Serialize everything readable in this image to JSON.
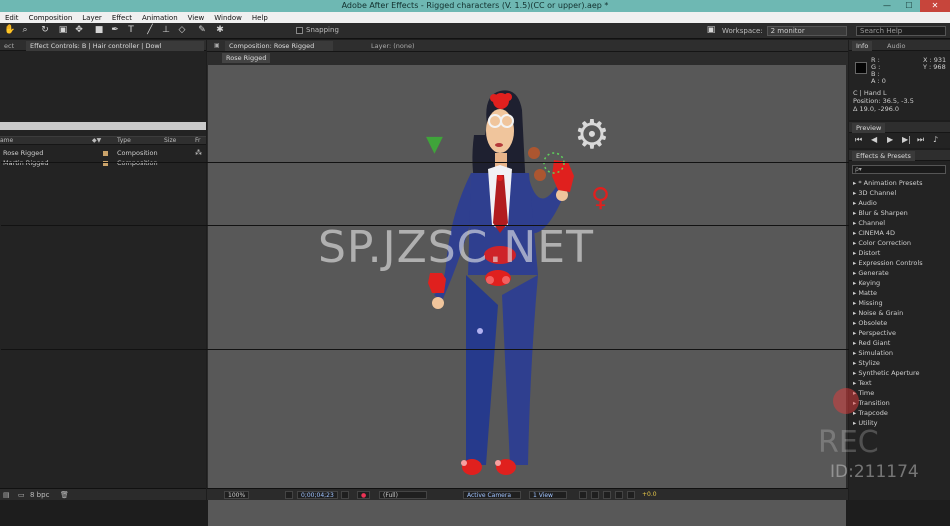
{
  "app": {
    "title": "Adobe After Effects - Rigged characters (V. 1.5)(CC or upper).aep *"
  },
  "window_controls": {
    "minimize": "—",
    "maximize": "☐",
    "close": "✕"
  },
  "menu": [
    "Edit",
    "Composition",
    "Layer",
    "Effect",
    "Animation",
    "View",
    "Window",
    "Help"
  ],
  "toolbar": {
    "snapping": "Snapping",
    "workspace_label": "Workspace:",
    "workspace_value": "2 monitor",
    "search_placeholder": "Search Help"
  },
  "left_panel": {
    "tabs": [
      "ect",
      "Effect Controls: B | Hair controller | Dowl"
    ],
    "columns": [
      "ame",
      "Type",
      "Size",
      "Fr"
    ],
    "rows": [
      {
        "name": "Rose Rigged",
        "type": "Composition"
      },
      {
        "name": "Martin Rigged",
        "type": "Composition"
      }
    ],
    "footer_bpc": "8 bpc"
  },
  "composition": {
    "tab_label": "Composition: Rose Rigged",
    "layer_tab": "Layer: (none)",
    "sub_tab": "Rose Rigged",
    "bottom": {
      "zoom": "100%",
      "timecode": "0;00;04;23",
      "resolution": "(Full)",
      "camera": "Active Camera",
      "view": "1 View",
      "exposure": "+0.0"
    }
  },
  "info_panel": {
    "tabs": [
      "Info",
      "Audio"
    ],
    "r": "R :",
    "g": "G :",
    "b": "B :",
    "a": "A : 0",
    "x": "X : 931",
    "y": "Y : 968",
    "layer": "C | Hand L",
    "position": "Position: 36.5, -3.5",
    "delta": "Δ 19.0, -296.0"
  },
  "preview_panel": {
    "tab": "Preview"
  },
  "effects_panel": {
    "tab": "Effects & Presets",
    "search": "ρ▾",
    "items": [
      "* Animation Presets",
      "3D Channel",
      "Audio",
      "Blur & Sharpen",
      "Channel",
      "CINEMA 4D",
      "Color Correction",
      "Distort",
      "Expression Controls",
      "Generate",
      "Keying",
      "Matte",
      "Missing",
      "Noise & Grain",
      "Obsolete",
      "Perspective",
      "Red Giant",
      "Simulation",
      "Stylize",
      "Synthetic Aperture",
      "Text",
      "Time",
      "Transition",
      "Trapcode",
      "Utility"
    ]
  },
  "watermark": {
    "text": "SP.JZSC.NET",
    "rec": "REC",
    "rec_id": "ID:211174"
  },
  "colors": {
    "accent_red": "#e0201e",
    "suit": "#2f3f8f",
    "titlebar": "#6eb8b3",
    "viewer_bg": "#585858"
  }
}
